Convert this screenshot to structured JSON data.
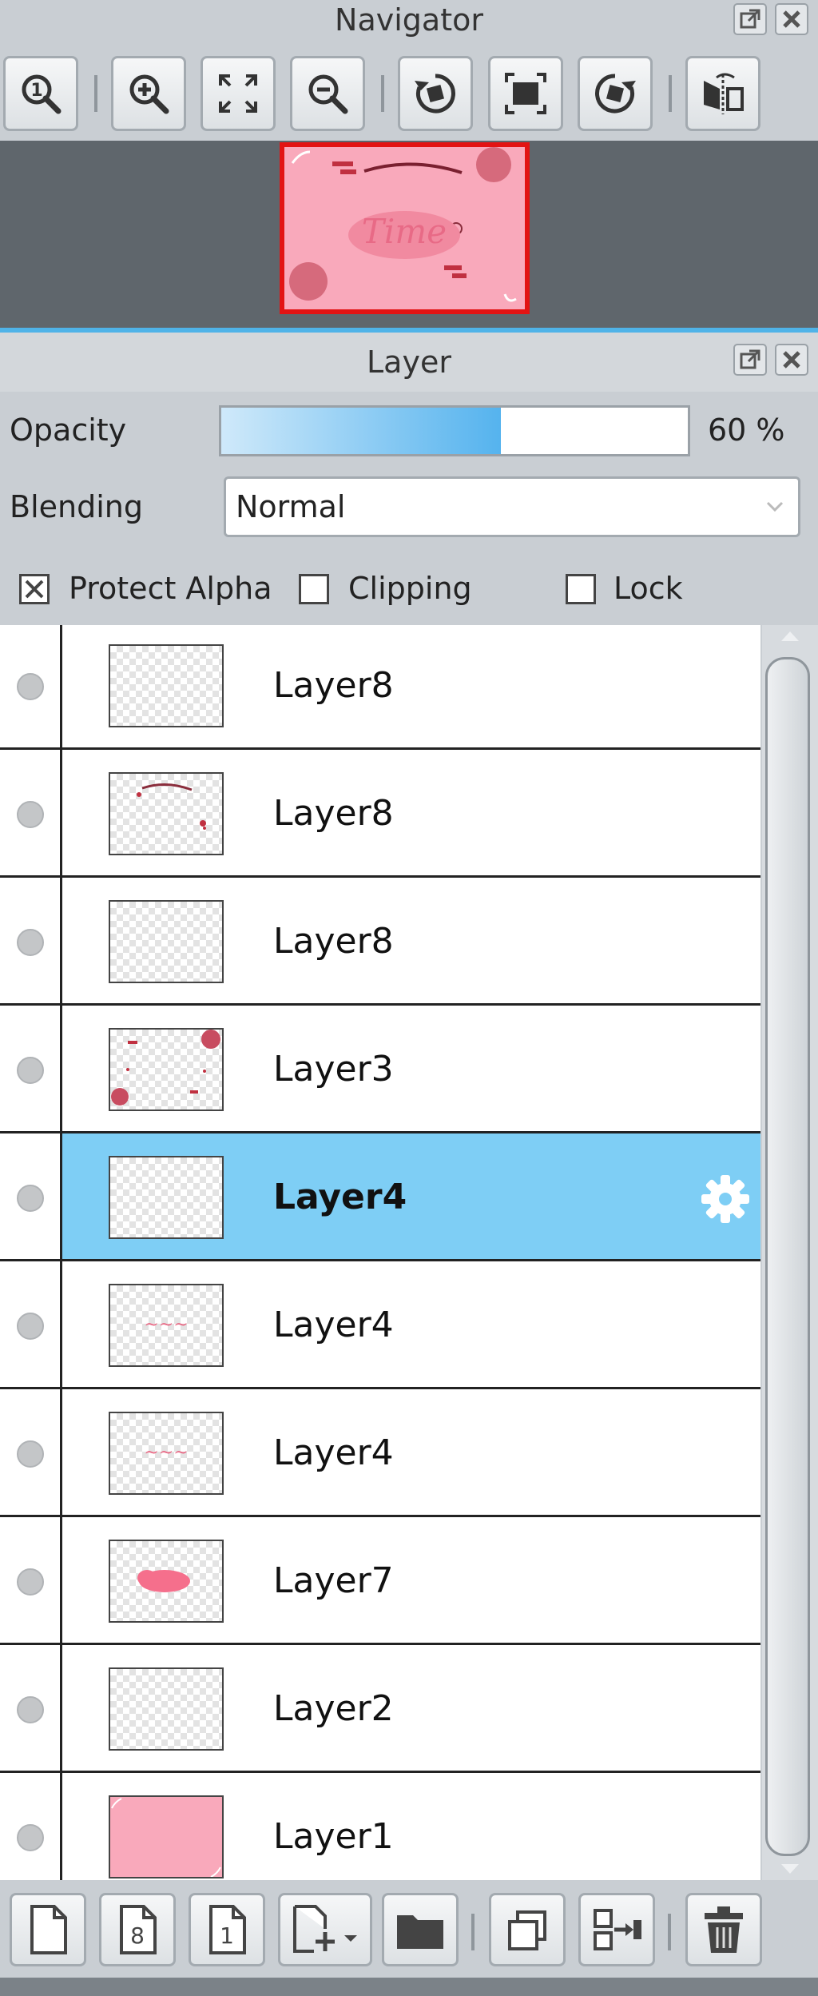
{
  "navigator": {
    "title": "Navigator",
    "toolbar": [
      {
        "name": "zoom-actual-button",
        "icon": "zoom-1-icon"
      },
      {
        "name": "zoom-in-button",
        "icon": "zoom-in-icon"
      },
      {
        "name": "fit-window-button",
        "icon": "fit-icon"
      },
      {
        "name": "zoom-out-button",
        "icon": "zoom-out-icon"
      },
      {
        "name": "rotate-left-button",
        "icon": "rotate-left-icon"
      },
      {
        "name": "reset-rotation-button",
        "icon": "reset-rotation-icon"
      },
      {
        "name": "rotate-right-button",
        "icon": "rotate-right-icon"
      },
      {
        "name": "flip-horizontal-button",
        "icon": "flip-icon"
      }
    ],
    "preview_text": "Time",
    "preview_border_color": "#e31313",
    "canvas_color": "#f9a9bb"
  },
  "layer_panel": {
    "title": "Layer",
    "opacity_label": "Opacity",
    "opacity_value": 60,
    "opacity_text": "60 %",
    "blending_label": "Blending",
    "blending_value": "Normal",
    "protect_alpha_label": "Protect Alpha",
    "protect_alpha_checked": true,
    "clipping_label": "Clipping",
    "clipping_checked": false,
    "lock_label": "Lock",
    "lock_checked": false,
    "accent_color": "#7ecef5"
  },
  "layers": [
    {
      "name": "Layer8",
      "selected": false,
      "thumb": "empty"
    },
    {
      "name": "Layer8",
      "selected": false,
      "thumb": "arc"
    },
    {
      "name": "Layer8",
      "selected": false,
      "thumb": "empty"
    },
    {
      "name": "Layer3",
      "selected": false,
      "thumb": "circles"
    },
    {
      "name": "Layer4",
      "selected": true,
      "thumb": "empty"
    },
    {
      "name": "Layer4",
      "selected": false,
      "thumb": "text"
    },
    {
      "name": "Layer4",
      "selected": false,
      "thumb": "text"
    },
    {
      "name": "Layer7",
      "selected": false,
      "thumb": "blob"
    },
    {
      "name": "Layer2",
      "selected": false,
      "thumb": "empty"
    },
    {
      "name": "Layer1",
      "selected": false,
      "thumb": "fill"
    }
  ],
  "bottom_toolbar": [
    {
      "name": "new-layer-button",
      "icon": "page-icon"
    },
    {
      "name": "new-8bit-layer-button",
      "icon": "page-8-icon",
      "label": "8"
    },
    {
      "name": "new-1bit-layer-button",
      "icon": "page-1-icon",
      "label": "1"
    },
    {
      "name": "add-layer-menu-button",
      "icon": "page-plus-dropdown-icon"
    },
    {
      "name": "new-folder-button",
      "icon": "folder-icon"
    },
    {
      "name": "duplicate-layer-button",
      "icon": "duplicate-icon"
    },
    {
      "name": "merge-down-button",
      "icon": "merge-icon"
    },
    {
      "name": "delete-layer-button",
      "icon": "trash-icon"
    }
  ]
}
